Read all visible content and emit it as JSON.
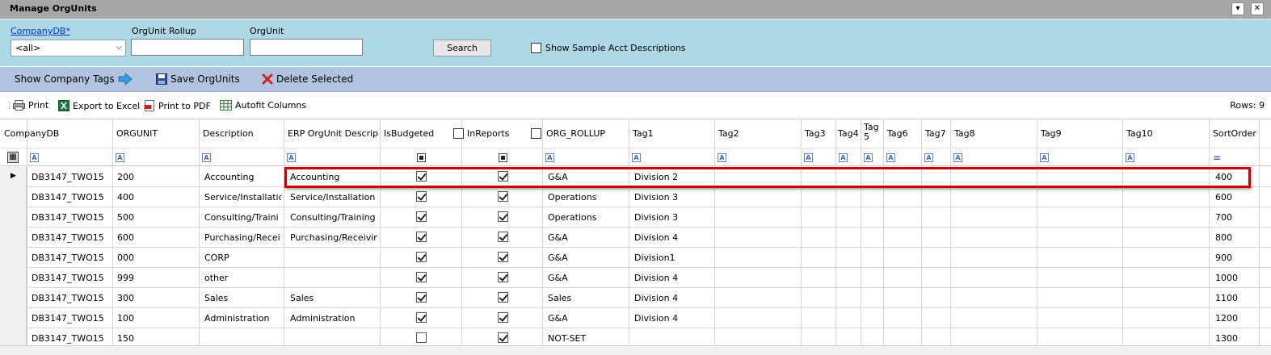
{
  "window": {
    "title": "Manage OrgUnits",
    "dropdown_glyph": "▾",
    "close_glyph": "✕"
  },
  "filters": {
    "companydb_label": "CompanyDB*",
    "companydb_value": "<all>",
    "rollup_label": "OrgUnit Rollup",
    "rollup_value": "",
    "orgunit_label": "OrgUnit",
    "orgunit_value": "",
    "search_label": "Search",
    "show_sample_label": "Show Sample Acct Descriptions"
  },
  "commands": {
    "show_tags": "Show Company Tags",
    "save": "Save OrgUnits",
    "delete": "Delete Selected"
  },
  "toolbar": {
    "print": "Print",
    "excel": "Export to Excel",
    "pdf": "Print to PDF",
    "autofit": "Autofit Columns",
    "rows": "Rows: 9"
  },
  "grid": {
    "headers": {
      "companydb": "CompanyDB",
      "orgunit": "ORGUNIT",
      "description": "Description",
      "erp": "ERP OrgUnit Descrip",
      "isbudgeted": "IsBudgeted",
      "inreports": "InReports",
      "rollup": "ORG_ROLLUP",
      "tag1": "Tag1",
      "tag2": "Tag2",
      "tag3": "Tag3",
      "tag4": "Tag4",
      "tag5": "Tag 5",
      "tag6": "Tag6",
      "tag7": "Tag7",
      "tag8": "Tag8",
      "tag9": "Tag9",
      "tag10": "Tag10",
      "sortorder": "SortOrder"
    },
    "rows": [
      {
        "db": "DB3147_TWO15",
        "org": "200",
        "desc": "Accounting",
        "erp": "Accounting",
        "bud": true,
        "rep": true,
        "rollup": "G&A",
        "tag1": "Division 2",
        "sort": "400"
      },
      {
        "db": "DB3147_TWO15",
        "org": "400",
        "desc": "Service/Installatio",
        "erp": "Service/Installation",
        "bud": true,
        "rep": true,
        "rollup": "Operations",
        "tag1": "Division 3",
        "sort": "600"
      },
      {
        "db": "DB3147_TWO15",
        "org": "500",
        "desc": "Consulting/Traini",
        "erp": "Consulting/Training",
        "bud": true,
        "rep": true,
        "rollup": "Operations",
        "tag1": "Division 3",
        "sort": "700"
      },
      {
        "db": "DB3147_TWO15",
        "org": "600",
        "desc": "Purchasing/Recei",
        "erp": "Purchasing/Receivin",
        "bud": true,
        "rep": true,
        "rollup": "G&A",
        "tag1": "Division 4",
        "sort": "800"
      },
      {
        "db": "DB3147_TWO15",
        "org": "000",
        "desc": "CORP",
        "erp": "",
        "bud": true,
        "rep": true,
        "rollup": "G&A",
        "tag1": "Division1",
        "sort": "900"
      },
      {
        "db": "DB3147_TWO15",
        "org": "999",
        "desc": "other",
        "erp": "",
        "bud": true,
        "rep": true,
        "rollup": "G&A",
        "tag1": "Division 4",
        "sort": "1000"
      },
      {
        "db": "DB3147_TWO15",
        "org": "300",
        "desc": "Sales",
        "erp": "Sales",
        "bud": true,
        "rep": true,
        "rollup": "Sales",
        "tag1": "Division 4",
        "sort": "1100"
      },
      {
        "db": "DB3147_TWO15",
        "org": "100",
        "desc": "Administration",
        "erp": "Administration",
        "bud": true,
        "rep": true,
        "rollup": "G&A",
        "tag1": "Division 4",
        "sort": "1200"
      },
      {
        "db": "DB3147_TWO15",
        "org": "150",
        "desc": "",
        "erp": "",
        "bud": false,
        "rep": true,
        "rollup": "NOT-SET",
        "tag1": "",
        "sort": "1300"
      }
    ]
  },
  "colors": {
    "filter_bg": "#add8e6",
    "command_bg": "#b1c4df",
    "highlight": "#cc0000"
  },
  "icons": [
    "arrow-right-icon",
    "save-disk-icon",
    "delete-x-icon",
    "printer-icon",
    "excel-icon",
    "pdf-icon",
    "autofit-icon"
  ]
}
